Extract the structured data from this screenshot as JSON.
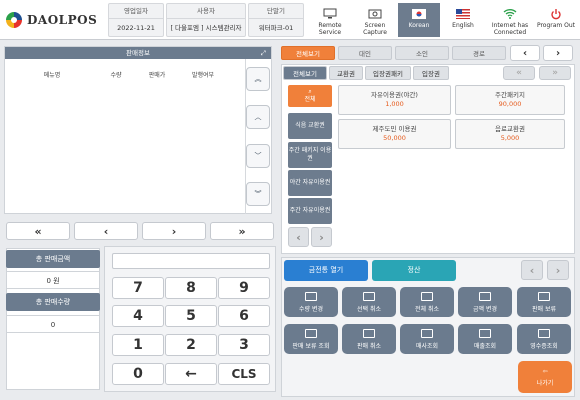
{
  "header": {
    "logo_text": "DAOLPOS",
    "business_date_label": "영업일자",
    "business_date": "2022-11-21",
    "user_label": "사용자",
    "user": "[ 다울포엠 ] 시스템관리자",
    "terminal_label": "단말기",
    "terminal": "워터파크-01",
    "buttons": {
      "remote": "Remote Service",
      "capture": "Screen Capture",
      "korean": "Korean",
      "english": "English",
      "internet": "Internet has Connected",
      "exit": "Program Out"
    }
  },
  "sale_info": {
    "title": "판매정보",
    "columns": [
      "메뉴명",
      "수량",
      "판매가",
      "발행여부"
    ]
  },
  "totals": {
    "total_amount_label": "총 판매금액",
    "total_amount": "0 원",
    "total_qty_label": "총 판매수량",
    "total_qty": "0"
  },
  "keypad": [
    "7",
    "8",
    "9",
    "4",
    "5",
    "6",
    "1",
    "2",
    "3",
    "0",
    "←",
    "CLS"
  ],
  "category_tabs": [
    "전체보기",
    "대인",
    "소인",
    "경로"
  ],
  "sub_tabs": [
    "전체보기",
    "교환권",
    "입장권패키",
    "입장권"
  ],
  "side_buttons": {
    "all": "전체",
    "b1": "식음 교환권",
    "b2": "주간 패키지 이용권",
    "b3": "야간 자유이용권",
    "b4": "주간 자유이용권"
  },
  "products": [
    {
      "name": "자유이용권(야간)",
      "price": "1,000"
    },
    {
      "name": "주간패키지",
      "price": "90,000"
    },
    {
      "name": "제주도민 이용권",
      "price": "50,000"
    },
    {
      "name": "음료교환권",
      "price": "5,000"
    }
  ],
  "actions": {
    "drawer": "금전통 열기",
    "settle": "정산"
  },
  "function_buttons": [
    {
      "label": "수량 변경",
      "icon": "edit-qty-icon"
    },
    {
      "label": "선택 취소",
      "icon": "cancel-select-icon"
    },
    {
      "label": "전체 취소",
      "icon": "cancel-all-icon"
    },
    {
      "label": "금액 변경",
      "icon": "change-amount-icon"
    },
    {
      "label": "판매 보류",
      "icon": "hold-sale-icon"
    },
    {
      "label": "판매 보류 조회",
      "icon": "hold-list-icon"
    },
    {
      "label": "판매 취소",
      "icon": "sale-cancel-icon"
    },
    {
      "label": "매사조회",
      "icon": "inquiry-icon"
    },
    {
      "label": "매출조회",
      "icon": "sales-icon"
    },
    {
      "label": "영수증조회",
      "icon": "receipt-icon"
    }
  ],
  "exit_label": "나가기",
  "colors": {
    "accent": "#f0803a",
    "panel": "#6b7b8e",
    "teal": "#2aa5b5",
    "blue": "#2a7fd2"
  }
}
